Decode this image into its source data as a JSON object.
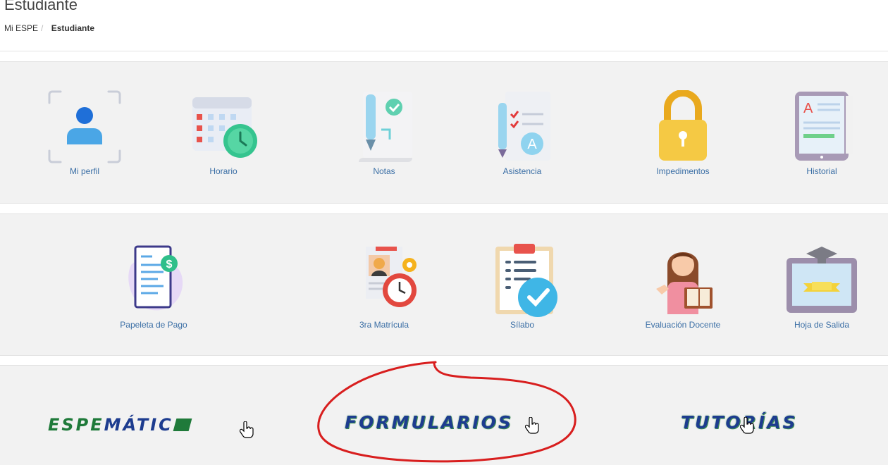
{
  "header": {
    "title": "Estudiante",
    "breadcrumb": [
      {
        "label": "Mi ESPE"
      },
      {
        "label": "Estudiante"
      }
    ]
  },
  "row1": [
    {
      "label": "Mi perfil",
      "icon": "user-profile-icon"
    },
    {
      "label": "Horario",
      "icon": "calendar-clock-icon"
    },
    {
      "label": "Notas",
      "icon": "notes-scroll-icon"
    },
    {
      "label": "Asistencia",
      "icon": "attendance-checklist-icon"
    },
    {
      "label": "Impedimentos",
      "icon": "padlock-icon"
    },
    {
      "label": "Historial",
      "icon": "tablet-history-icon"
    }
  ],
  "row2": [
    {
      "label": "Papeleta de Pago",
      "icon": "payment-receipt-icon"
    },
    {
      "label": "3ra Matrícula",
      "icon": "enrollment-timer-icon"
    },
    {
      "label": "Sílabo",
      "icon": "syllabus-clipboard-icon"
    },
    {
      "label": "Evaluación Docente",
      "icon": "teacher-evaluation-icon"
    },
    {
      "label": "Hoja de Salida",
      "icon": "graduation-diploma-icon"
    }
  ],
  "links": {
    "espematico": {
      "part1": "ESPE",
      "part2": "MÁTIC"
    },
    "formularios": {
      "label": "FORMULARIOS"
    },
    "tutorias": {
      "label": "TUTORÍAS"
    }
  },
  "colors": {
    "link_blue": "#3a6ea5",
    "brand_green": "#1f7a3a",
    "brand_navy": "#1d3c8f",
    "annotation_red": "#d81e1e"
  }
}
